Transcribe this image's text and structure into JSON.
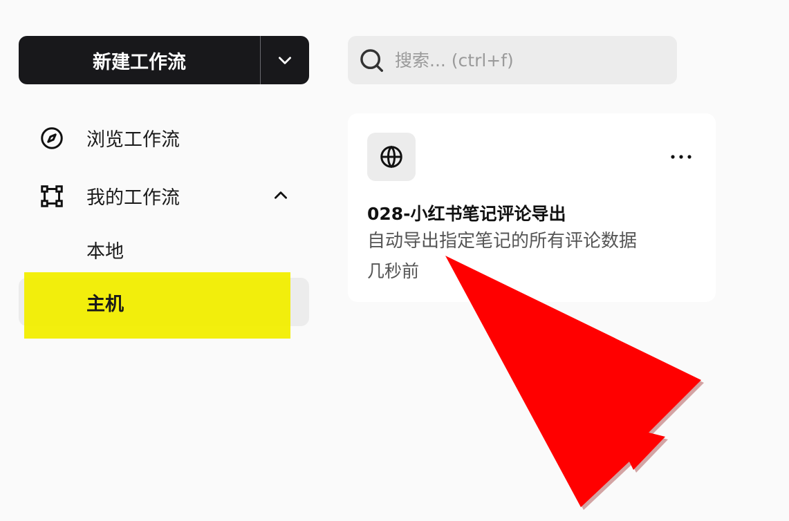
{
  "sidebar": {
    "new_workflow_label": "新建工作流",
    "items": [
      {
        "label": "浏览工作流",
        "icon": "compass-icon"
      },
      {
        "label": "我的工作流",
        "icon": "workflow-icon",
        "expanded": true
      }
    ],
    "sub_items": [
      {
        "label": "本地"
      },
      {
        "label": "主机",
        "active": true
      }
    ]
  },
  "search": {
    "placeholder": "搜索... (ctrl+f)",
    "value": ""
  },
  "workflow_card": {
    "icon": "globe-icon",
    "title": "028-小红书笔记评论导出",
    "description": "自动导出指定笔记的所有评论数据",
    "time": "几秒前"
  },
  "annotations": {
    "highlight_color": "#f2ee00",
    "arrow_color": "#ff0000"
  }
}
